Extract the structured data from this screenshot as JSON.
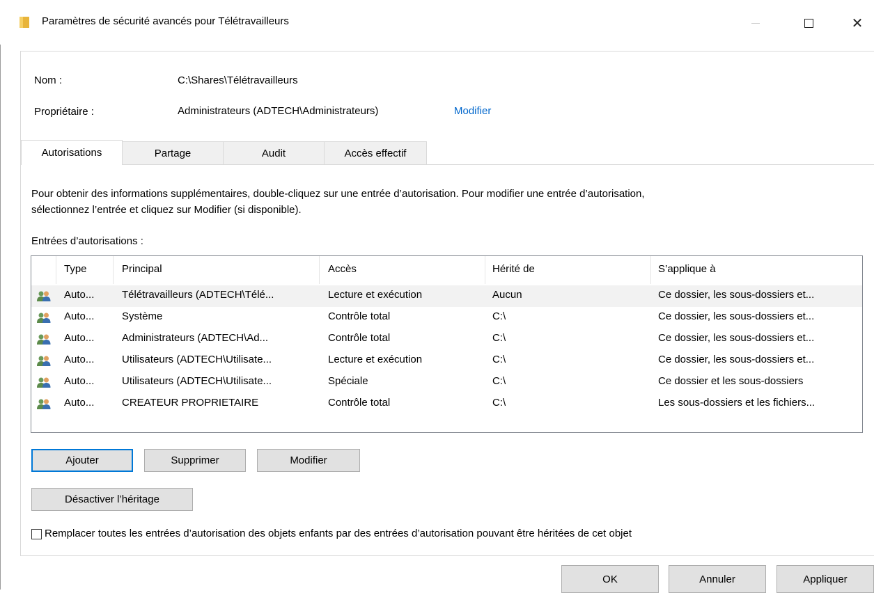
{
  "window": {
    "title": "Paramètres de sécurité avancés pour Télétravailleurs",
    "close_glyph": "✕"
  },
  "info": {
    "name_label": "Nom :",
    "name_value": "C:\\Shares\\Télétravailleurs",
    "owner_label": "Propriétaire :",
    "owner_value": "Administrateurs (ADTECH\\Administrateurs)",
    "owner_modify_link": "Modifier"
  },
  "tabs": [
    {
      "label": "Autorisations",
      "active": true
    },
    {
      "label": "Partage",
      "active": false
    },
    {
      "label": "Audit",
      "active": false
    },
    {
      "label": "Accès effectif",
      "active": false
    }
  ],
  "description": {
    "line1": "Pour obtenir des informations supplémentaires, double-cliquez sur une entrée d’autorisation. Pour modifier une entrée d’autorisation,",
    "line2": "sélectionnez l’entrée et cliquez sur Modifier (si disponible)."
  },
  "entries_label": "Entrées d’autorisations :",
  "table": {
    "columns": [
      "Type",
      "Principal",
      "Accès",
      "Hérité de",
      "S’applique à"
    ],
    "rows": [
      {
        "icon": "users-group-icon",
        "type": "Auto...",
        "principal": "Télétravailleurs (ADTECH\\Télé...",
        "access": "Lecture et exécution",
        "inherited": "Aucun",
        "applies": "Ce dossier, les sous-dossiers et...",
        "selected": true
      },
      {
        "icon": "users-group-icon",
        "type": "Auto...",
        "principal": "Système",
        "access": "Contrôle total",
        "inherited": "C:\\",
        "applies": "Ce dossier, les sous-dossiers et...",
        "selected": false
      },
      {
        "icon": "users-group-icon",
        "type": "Auto...",
        "principal": "Administrateurs (ADTECH\\Ad...",
        "access": "Contrôle total",
        "inherited": "C:\\",
        "applies": "Ce dossier, les sous-dossiers et...",
        "selected": false
      },
      {
        "icon": "users-group-icon",
        "type": "Auto...",
        "principal": "Utilisateurs (ADTECH\\Utilisate...",
        "access": "Lecture et exécution",
        "inherited": "C:\\",
        "applies": "Ce dossier, les sous-dossiers et...",
        "selected": false
      },
      {
        "icon": "users-group-icon",
        "type": "Auto...",
        "principal": "Utilisateurs (ADTECH\\Utilisate...",
        "access": "Spéciale",
        "inherited": "C:\\",
        "applies": "Ce dossier et les sous-dossiers",
        "selected": false
      },
      {
        "icon": "users-group-icon",
        "type": "Auto...",
        "principal": "CREATEUR PROPRIETAIRE",
        "access": "Contrôle total",
        "inherited": "C:\\",
        "applies": "Les sous-dossiers et les fichiers...",
        "selected": false
      }
    ]
  },
  "buttons": {
    "add": "Ajouter",
    "remove": "Supprimer",
    "edit": "Modifier",
    "disable_inheritance": "Désactiver l’héritage",
    "ok": "OK",
    "cancel": "Annuler",
    "apply": "Appliquer"
  },
  "replace_checkbox": {
    "label": "Remplacer toutes les entrées d’autorisation des objets enfants par des entrées d’autorisation pouvant être héritées de cet objet",
    "checked": false
  },
  "colors": {
    "link": "#0066cc",
    "selected_row": "#f2f2f2",
    "default_button_border": "#0078d7",
    "button_bg": "#e1e1e1"
  }
}
